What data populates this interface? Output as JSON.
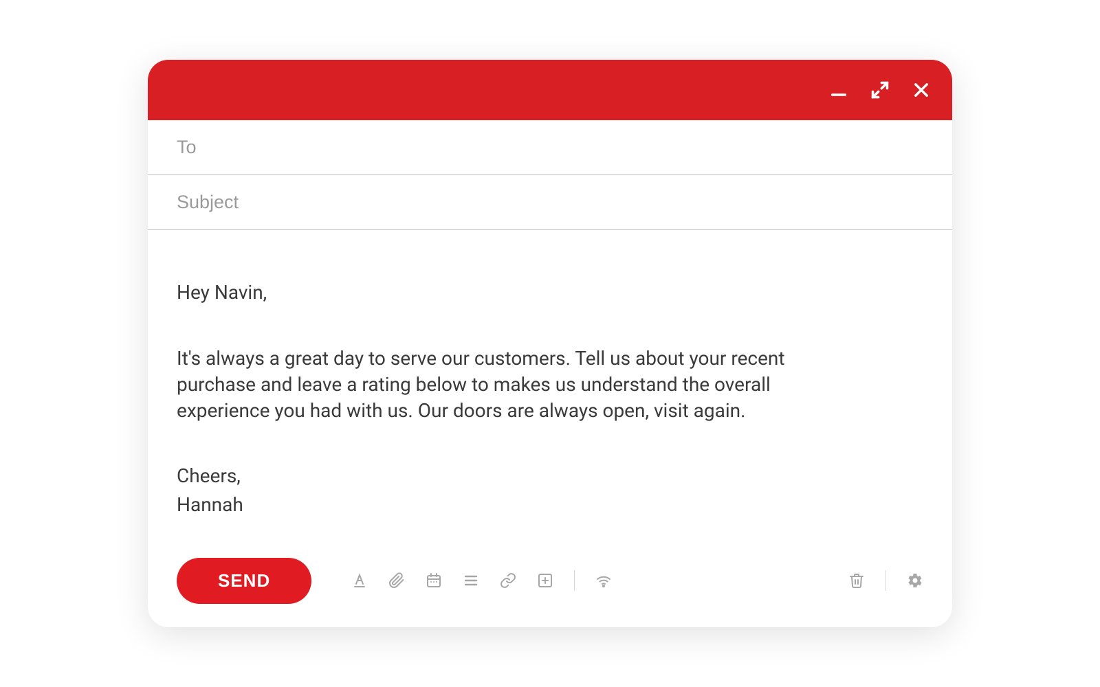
{
  "colors": {
    "accent": "#d81f24",
    "send_button": "#e11b22",
    "icon": "#a7a7a7"
  },
  "fields": {
    "to_placeholder": "To",
    "to_value": "",
    "subject_placeholder": "Subject",
    "subject_value": ""
  },
  "body": {
    "greeting": "Hey Navin,",
    "main": "It's always a great day to serve our customers. Tell us about your recent purchase and leave a rating below to makes us understand the overall experience you had with us. Our doors are always open, visit again.",
    "signoff": "Cheers,",
    "signature": "Hannah"
  },
  "footer": {
    "send_label": "SEND"
  },
  "titlebar_icons": {
    "minimize": "minimize-icon",
    "expand": "expand-icon",
    "close": "close-icon"
  },
  "toolbar_icons": {
    "text_color": "text-color-icon",
    "attach": "paperclip-icon",
    "calendar": "calendar-icon",
    "list": "list-icon",
    "link": "link-icon",
    "add": "add-box-icon",
    "wifi": "wifi-icon",
    "trash": "trash-icon",
    "settings": "gear-icon"
  }
}
